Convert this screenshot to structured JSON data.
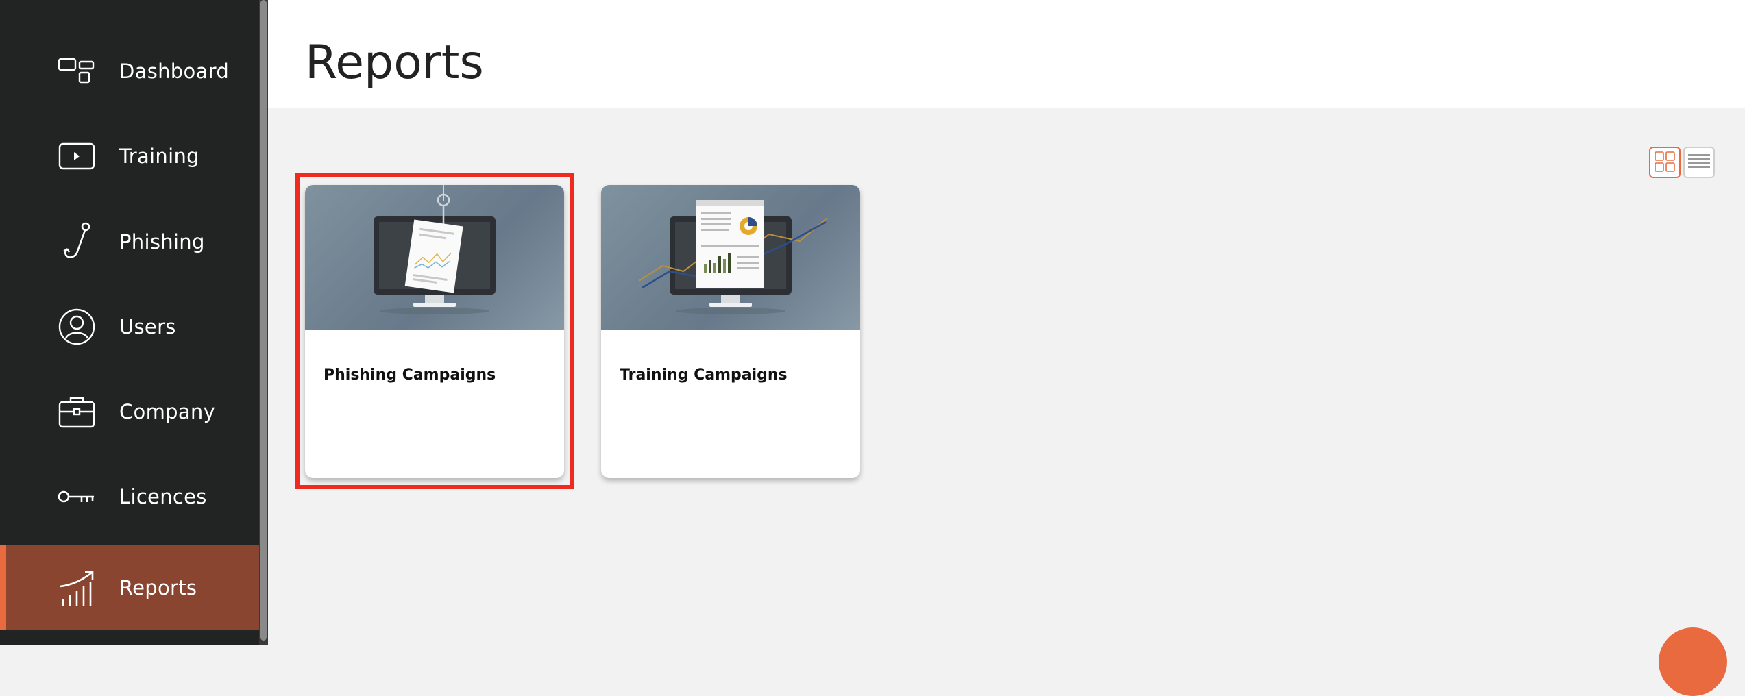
{
  "sidebar": {
    "items": [
      {
        "label": "Dashboard",
        "icon": "dashboard-icon"
      },
      {
        "label": "Training",
        "icon": "play-icon"
      },
      {
        "label": "Phishing",
        "icon": "hook-icon"
      },
      {
        "label": "Users",
        "icon": "user-icon"
      },
      {
        "label": "Company",
        "icon": "briefcase-icon"
      },
      {
        "label": "Licences",
        "icon": "key-icon"
      },
      {
        "label": "Reports",
        "icon": "trend-chart-icon",
        "active": true
      }
    ]
  },
  "header": {
    "title": "Reports"
  },
  "view_toggle": {
    "grid_icon": "grid-view-icon",
    "list_icon": "list-view-icon",
    "active": "grid"
  },
  "cards": [
    {
      "title": "Phishing Campaigns",
      "image": "monitor-hooked-report-illustration"
    },
    {
      "title": "Training Campaigns",
      "image": "monitor-report-chart-illustration"
    }
  ],
  "colors": {
    "accent": "#e96a3f",
    "sidebar_bg": "#222423",
    "active_bg": "#8a4530",
    "highlight": "#f02a1f"
  }
}
